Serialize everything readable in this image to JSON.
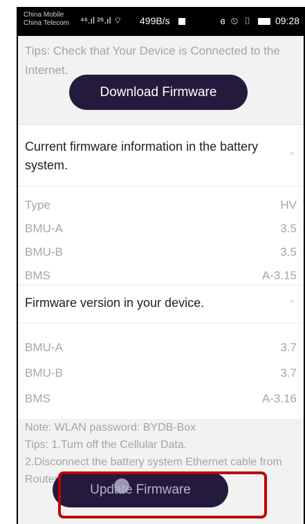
{
  "status_bar": {
    "carrier_1": "China Mobile",
    "carrier_2": "China Telecom",
    "signal": "⁴⁶.ıl ²⁶.ıl ⌔",
    "net_speed": "499B/s",
    "right_icons": "ɞ ⏲ ▯",
    "time": "09:28"
  },
  "tips_connect": "Tips: Check that Your Device is Connected to the Internet.",
  "download_button": "Download Firmware",
  "battery_section": {
    "title": "Current firmware information in the battery system.",
    "chevron": "^",
    "rows": [
      {
        "label": "Type",
        "value": "HV"
      },
      {
        "label": "BMU-A",
        "value": "3.5"
      },
      {
        "label": "BMU-B",
        "value": "3.5"
      },
      {
        "label": "BMS",
        "value": "A-3.15"
      }
    ]
  },
  "device_section": {
    "title": "Firmware version in your device.",
    "chevron": "^",
    "rows": [
      {
        "label": "BMU-A",
        "value": "3.7"
      },
      {
        "label": "BMU-B",
        "value": "3.7"
      },
      {
        "label": "BMS",
        "value": "A-3.16"
      }
    ]
  },
  "notes": {
    "wlan": "Note: WLAN password: BYDB-Box",
    "tip1": "Tips: 1.Turn off the Cellular Data.",
    "tip2": "2.Disconnect the battery system Ethernet cable from",
    "tip3": "Router."
  },
  "update_button": "Update Firmware",
  "colors": {
    "button_bg": "#231a3d",
    "highlight_border": "#c00000"
  }
}
